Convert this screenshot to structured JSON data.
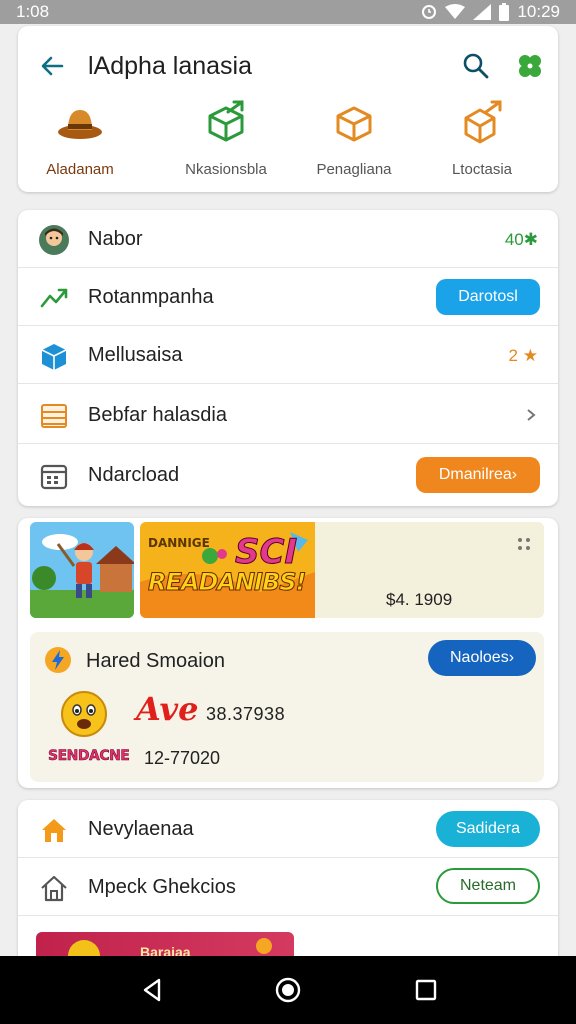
{
  "status_bar": {
    "time_left": "1:08",
    "time_right": "10:29"
  },
  "app_bar": {
    "title": "lAdpha lanasia",
    "icons": [
      "back-arrow-icon",
      "search-icon",
      "clover-icon"
    ]
  },
  "categories": [
    {
      "label": "Aladanam",
      "icon": "hat-icon",
      "active": true
    },
    {
      "label": "Nkasionsbla",
      "icon": "cube-arrow-icon",
      "active": false
    },
    {
      "label": "Penagliana",
      "icon": "box-icon",
      "active": false
    },
    {
      "label": "Ltoctasia",
      "icon": "box-arrow-icon",
      "active": false
    }
  ],
  "list": [
    {
      "label": "Nabor",
      "icon": "avatar-icon",
      "trail_text": "40"
    },
    {
      "label": "Rotanmpanha",
      "icon": "chart-arrow-icon",
      "button": "Darotosl"
    },
    {
      "label": "Mellusaisa",
      "icon": "package-icon",
      "trail_text": "2"
    },
    {
      "label": "Bebfar halasdia",
      "icon": "ledger-icon",
      "trail": "chevron-right-icon"
    },
    {
      "label": "Ndarcload",
      "icon": "calendar-icon",
      "button": "Dmanilrea›"
    }
  ],
  "promo": {
    "banner_text_top": "DANNIGE",
    "banner_text_main": "READANIBS!",
    "banner_text_sci": "SCI",
    "banner_price": "$4. 1909",
    "inner_title": "Hared Smoaion",
    "inner_button": "Naoloes›",
    "ave_logo": "Ave",
    "ave_value": "38.37938",
    "stamp_logo": "SENDACNE",
    "stamp_value": "12-77020"
  },
  "bottom": [
    {
      "label": "Nevylaenaa",
      "icon": "home-orange-icon",
      "button": "Sadidera"
    },
    {
      "label": "Mpeck Ghekcios",
      "icon": "home-outline-icon",
      "button": "Neteam"
    }
  ],
  "thumb_text": "Baraiaa"
}
